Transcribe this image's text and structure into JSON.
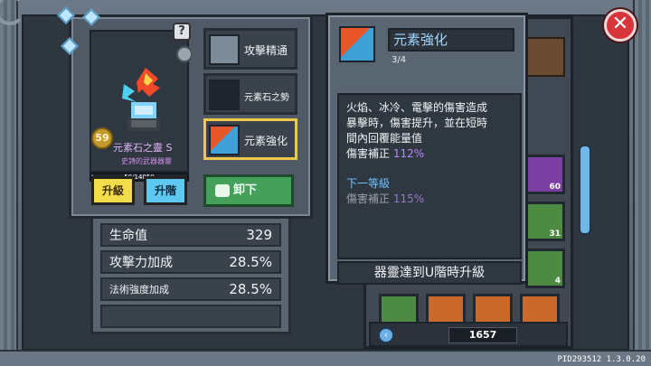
{
  "item": {
    "level": "59",
    "name": "元素石之靈 S",
    "subtitle": "史詩的武器器靈",
    "exp_text": "50/14850",
    "exp_fraction": 0.0034
  },
  "buttons": {
    "help": "?",
    "upgrade": "升級",
    "ascend": "升階",
    "unequip": "卸下",
    "close": "✕"
  },
  "skills": [
    {
      "label": "攻擊精通",
      "icon": "dagger-icon"
    },
    {
      "label": "元素石之勢",
      "icon": "orb-icon"
    },
    {
      "label": "元素強化",
      "icon": "elemental-icon"
    }
  ],
  "stats": [
    {
      "name": "生命值",
      "value": "329"
    },
    {
      "name": "攻擊力加成",
      "value": "28.5%"
    },
    {
      "name": "法術強度加成",
      "value": "28.5%"
    }
  ],
  "tooltip": {
    "title": "元素強化",
    "progress": "3/4",
    "description": "火焰、冰冷、電擊的傷害造成\n暴擊時，傷害提升，並在短時\n間內回覆能量值",
    "bonus_label": "傷害補正",
    "bonus_value": "112%",
    "next_title": "下一等級",
    "next_label": "傷害補正",
    "next_value": "115%",
    "footer": "器靈達到U階時升級"
  },
  "inventory": {
    "counts": [
      "60",
      "31",
      "4"
    ],
    "gold": "1657",
    "back": "‹"
  },
  "version": "PID293512 1.3.0.20"
}
